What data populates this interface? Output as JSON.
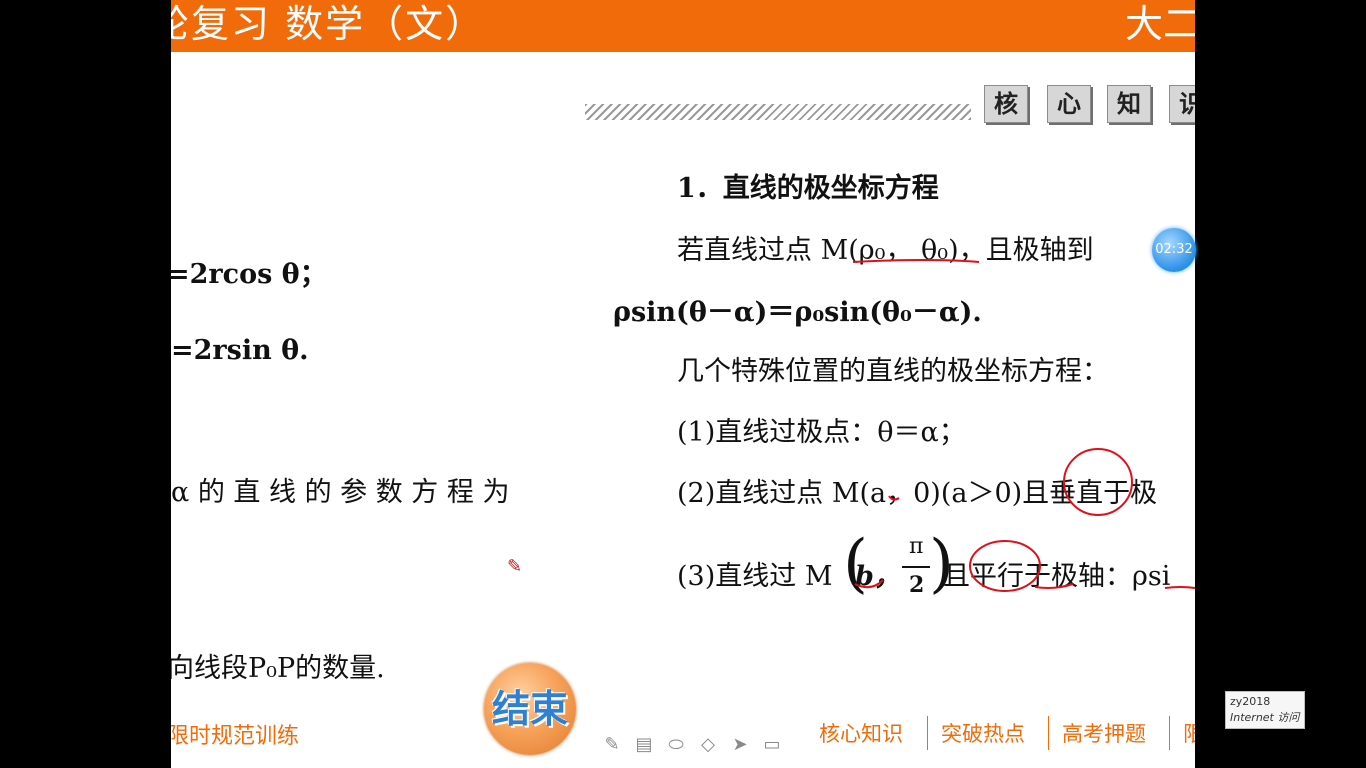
{
  "header": {
    "title": "轮复习  数学（文）",
    "right_text": "大二"
  },
  "tabs": [
    "核",
    "心",
    "知",
    "识"
  ],
  "left_content": {
    "line1": "=2rcos  θ；",
    "line2": "=2rsin  θ.",
    "line3": "α 的 直 线 的 参 数 方 程 为",
    "line4": "向线段P₀P的数量."
  },
  "right_content": {
    "heading": "1．直线的极坐标方程",
    "p1": "若直线过点 M(ρ₀， θ₀)，且极轴到",
    "p2": "ρsin(θ－α)＝ρ₀sin(θ₀－α).",
    "p3": "几个特殊位置的直线的极坐标方程：",
    "item1": "(1)直线过极点：θ＝α；",
    "item2": "(2)直线过点 M(a，0)(a＞0)且垂直于极",
    "item3_prefix": "(3)直线过 M",
    "item3_b": "b，",
    "item3_num": "π",
    "item3_den": "2",
    "item3_suffix": "且平行于极轴：ρsi"
  },
  "footer": {
    "left": "限时规范训练",
    "end_button": "结束",
    "nav": [
      "核心知识",
      "突破热点",
      "高考押题",
      "限"
    ]
  },
  "toolbar_icons": [
    "pen-icon",
    "text-icon",
    "eraser-icon",
    "highlighter-icon",
    "pointer-icon",
    "screen-icon"
  ],
  "timer": "02:32",
  "visit_badge": {
    "user": "zy2018",
    "label": "Internet 访问"
  },
  "colors": {
    "accent": "#f26b0a",
    "ink": "#e0101a"
  }
}
